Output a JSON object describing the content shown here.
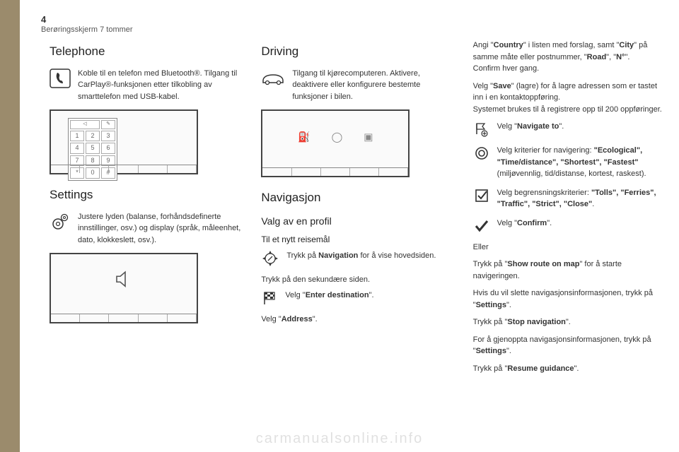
{
  "page_number": "4",
  "doc_title": "Berøringsskjerm 7 tommer",
  "watermark": "carmanualsonline.info",
  "col1": {
    "telephone_heading": "Telephone",
    "telephone_desc": "Koble til en telefon med Bluetooth®. Tilgang til CarPlay®-funksjonen etter tilkobling av smarttelefon med USB-kabel.",
    "keypad": {
      "r1": [
        "1",
        "2",
        "3"
      ],
      "r2": [
        "4",
        "5",
        "6"
      ],
      "r3": [
        "7",
        "8",
        "9"
      ],
      "r4": [
        "*",
        "0",
        "#"
      ]
    },
    "settings_heading": "Settings",
    "settings_desc": "Justere lyden (balanse, forhåndsdefinerte innstillinger, osv.) og display (språk, måleenhet, dato, klokkeslett, osv.)."
  },
  "col2": {
    "driving_heading": "Driving",
    "driving_desc": "Tilgang til kjørecomputeren. Aktivere, deaktivere eller konfigurere bestemte funksjoner i bilen.",
    "nav_heading": "Navigasjon",
    "nav_sub1": "Valg av en profil",
    "nav_sub2": "Til et nytt reisemål",
    "nav_press": "Trykk på ",
    "nav_press_b": "Navigation",
    "nav_press_after": " for å vise hovedsiden.",
    "secondary": "Trykk på den sekundære siden.",
    "enter_dest_pre": "Velg \"",
    "enter_dest_b": "Enter destination",
    "enter_dest_post": "\".",
    "address_pre": "Velg \"",
    "address_b": "Address",
    "address_post": "\"."
  },
  "col3": {
    "p1_a": "Angi \"",
    "p1_country": "Country",
    "p1_b": "\" i listen med forslag, samt \"",
    "p1_city": "City",
    "p1_c": "\" på samme måte eller postnummer, \"",
    "p1_road": "Road",
    "p1_d": "\", \"",
    "p1_n": "N°",
    "p1_e": "\".",
    "p1_confirm": "Confirm hver gang.",
    "p2_a": "Velg \"",
    "p2_save": "Save",
    "p2_b": "\" (lagre) for å lagre adressen som er tastet inn i en kontaktoppføring.",
    "p2_c": "Systemet brukes til å registrere opp til 200 oppføringer.",
    "navto_pre": "Velg \"",
    "navto_b": "Navigate to",
    "navto_post": "\".",
    "criteria_a": "Velg kriterier for navigering:",
    "criteria_b": " \"Ecological\", \"Time/distance\", \"Shortest\", \"Fastest\"",
    "criteria_c": " (miljøvennlig, tid/distanse, kortest, raskest).",
    "limits_a": "Velg begrensningskriterier: ",
    "limits_b": "\"Tolls\", \"Ferries\", \"Traffic\", \"Strict\", \"Close\"",
    "limits_c": ".",
    "confirm_pre": "Velg \"",
    "confirm_b": "Confirm",
    "confirm_post": "\".",
    "eller": "Eller",
    "show_a": "Trykk på \"",
    "show_b": "Show route on map",
    "show_c": "\" for å starte navigeringen.",
    "del_a": "Hvis du vil slette navigasjonsinformasjonen, trykk på \"",
    "del_b": "Settings",
    "del_c": "\".",
    "stop_a": "Trykk på \"",
    "stop_b": "Stop navigation",
    "stop_c": "\".",
    "res_a": "For å gjenoppta navigasjonsinformasjonen, trykk på \"",
    "res_b": "Settings",
    "res_c": "\".",
    "resg_a": "Trykk på \"",
    "resg_b": "Resume guidance",
    "resg_c": "\"."
  }
}
